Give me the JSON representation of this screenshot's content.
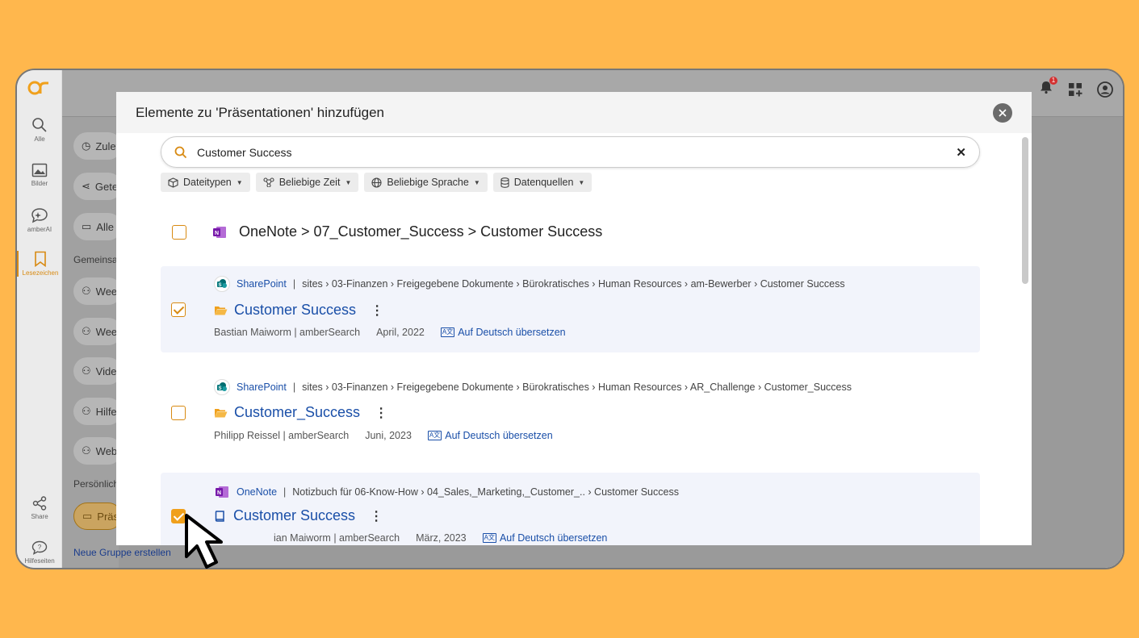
{
  "app": {
    "nav": [
      {
        "label": "Alle",
        "icon": "search-icon"
      },
      {
        "label": "Bilder",
        "icon": "image-icon"
      },
      {
        "label": "amberAI",
        "icon": "ai-chat-icon"
      },
      {
        "label": "Lesezeichen",
        "icon": "bookmark-icon",
        "active": true
      },
      {
        "label": "Share",
        "icon": "share-icon"
      },
      {
        "label": "Hilfeseiten",
        "icon": "help-icon"
      }
    ],
    "notification_count": "1"
  },
  "background": {
    "items": [
      {
        "label": "Zuletz",
        "icon": "clock-icon"
      },
      {
        "label": "Gete",
        "icon": "share-icon"
      },
      {
        "label": "Alle I",
        "icon": "folder-icon"
      },
      {
        "label": "Wee",
        "icon": "users-icon"
      },
      {
        "label": "Wee",
        "icon": "users-icon"
      },
      {
        "label": "Vide",
        "icon": "users-icon"
      },
      {
        "label": "Hilfe",
        "icon": "users-icon"
      },
      {
        "label": "Web",
        "icon": "users-icon"
      },
      {
        "label": "Präse",
        "icon": "folder-icon"
      }
    ],
    "section_shared": "Gemeinsam",
    "section_personal": "Persönlich",
    "new_group": "Neue Gruppe erstellen"
  },
  "modal": {
    "title": "Elemente zu 'Präsentationen' hinzufügen",
    "search": {
      "value": "Customer Success"
    },
    "filters": [
      {
        "label": "Dateitypen",
        "icon": "cube-icon"
      },
      {
        "label": "Beliebige Zeit",
        "icon": "time-filter-icon"
      },
      {
        "label": "Beliebige Sprache",
        "icon": "globe-icon"
      },
      {
        "label": "Datenquellen",
        "icon": "database-icon"
      }
    ],
    "top_item": {
      "breadcrumb": "OneNote > 07_Customer_Success > Customer Success",
      "checked": false
    },
    "results": [
      {
        "source": "SharePoint",
        "path": "sites › 03-Finanzen › Freigegebene Dokumente › Bürokratisches › Human Resources › am-Bewerber › Customer Success",
        "title": "Customer Success",
        "type_icon": "folder-icon",
        "author": "Bastian Maiworm | amberSearch",
        "date": "April, 2022",
        "translate": "Auf Deutsch übersetzen",
        "checked": true
      },
      {
        "source": "SharePoint",
        "path": "sites › 03-Finanzen › Freigegebene Dokumente › Bürokratisches › Human Resources › AR_Challenge › Customer_Success",
        "title": "Customer_Success",
        "type_icon": "folder-icon",
        "author": "Philipp Reissel | amberSearch",
        "date": "Juni, 2023",
        "translate": "Auf Deutsch übersetzen",
        "checked": false
      },
      {
        "source": "OneNote",
        "path": "Notizbuch für 06-Know-How › 04_Sales,_Marketing,_Customer_.. › Customer Success",
        "title": "Customer Success",
        "type_icon": "notebook-icon",
        "author": "Bastian Maiworm | amberSearch",
        "author_visible": "ian Maiworm | amberSearch",
        "date": "März, 2023",
        "translate": "Auf Deutsch übersetzen",
        "checked": true
      }
    ]
  },
  "colors": {
    "backdrop": "#FFB74D",
    "accent": "#D88A12",
    "link": "#1a4fa8"
  }
}
